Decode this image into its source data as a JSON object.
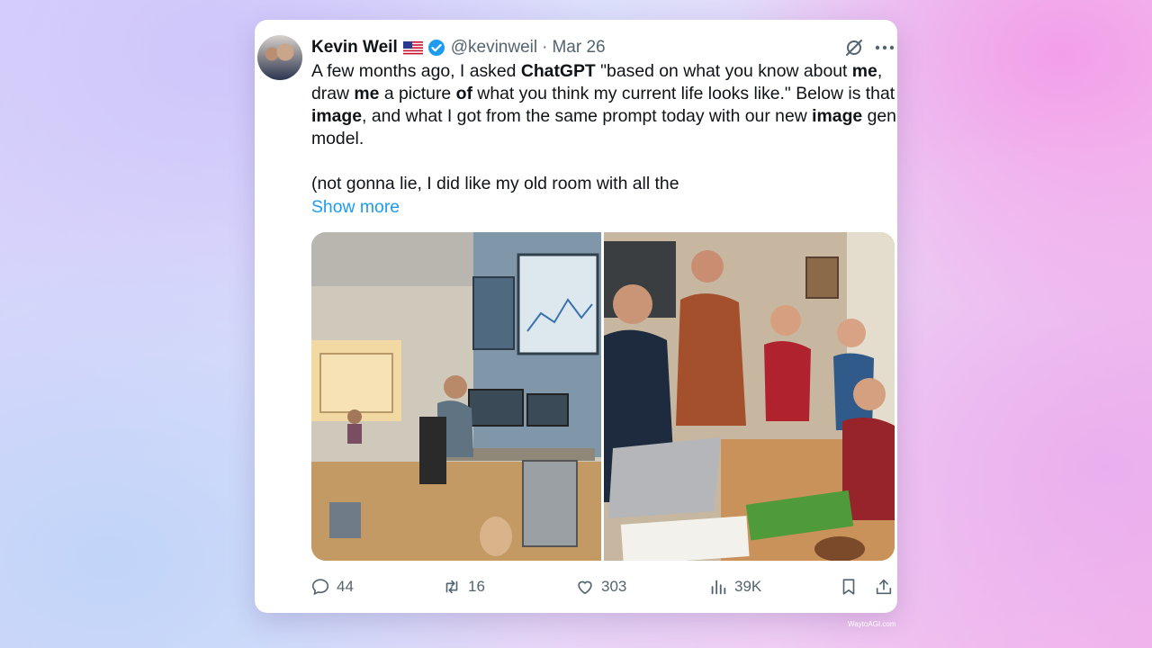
{
  "tweet": {
    "author_name": "Kevin Weil",
    "handle": "@kevinweil",
    "separator": "·",
    "date": "Mar 26",
    "text_line1_a": "A few months ago, I asked ",
    "text_line1_b": "ChatGPT",
    "text_line1_c": " \"based on what you know about ",
    "text_line1_d": "me",
    "text_line1_e": ",",
    "text_line2_a": "draw ",
    "text_line2_b": "me",
    "text_line2_c": " a picture ",
    "text_line2_d": "of",
    "text_line2_e": " what you think my current life looks like.\" Below is that",
    "text_line3_a": "image",
    "text_line3_b": ", and what I got from the same prompt today with our new ",
    "text_line3_c": "image",
    "text_line3_d": " gen",
    "text_line4": "model.",
    "text_paragraph2": "(not gonna lie, I did like my old room with all the",
    "show_more": "Show more"
  },
  "actions": {
    "replies": "44",
    "retweets": "16",
    "likes": "303",
    "views": "39K"
  },
  "icons": {
    "verified": "verified-badge-icon",
    "flag": "us-flag-icon",
    "grok": "grok-icon",
    "more": "more-icon",
    "reply": "reply-icon",
    "retweet": "retweet-icon",
    "like": "heart-icon",
    "views": "views-chart-icon",
    "bookmark": "bookmark-icon",
    "share": "share-icon"
  },
  "colors": {
    "link": "#1d9bf0",
    "text": "#0f1419",
    "muted": "#536471"
  },
  "watermark": "WaytoAGI.com"
}
